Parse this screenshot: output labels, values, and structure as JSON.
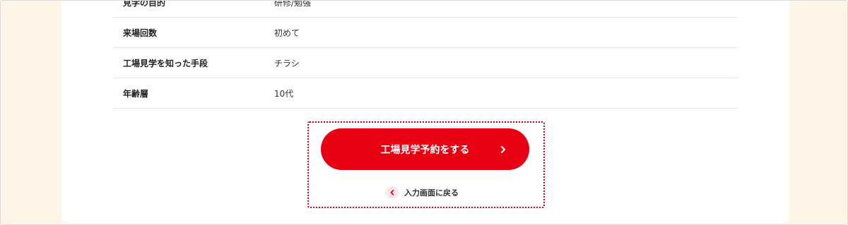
{
  "rows": [
    {
      "label": "見学の目的",
      "value": "研修/勉強"
    },
    {
      "label": "来場回数",
      "value": "初めて"
    },
    {
      "label": "工場見学を知った手段",
      "value": "チラシ"
    },
    {
      "label": "年齢層",
      "value": "10代"
    }
  ],
  "actions": {
    "submit_label": "工場見学予約をする",
    "back_label": "入力画面に戻る"
  },
  "colors": {
    "accent": "#e60012",
    "page_background": "#fdf5e8",
    "card_background": "#ffffff"
  },
  "icons": {
    "submit": "chevron-right-icon",
    "back": "chevron-left-icon"
  }
}
